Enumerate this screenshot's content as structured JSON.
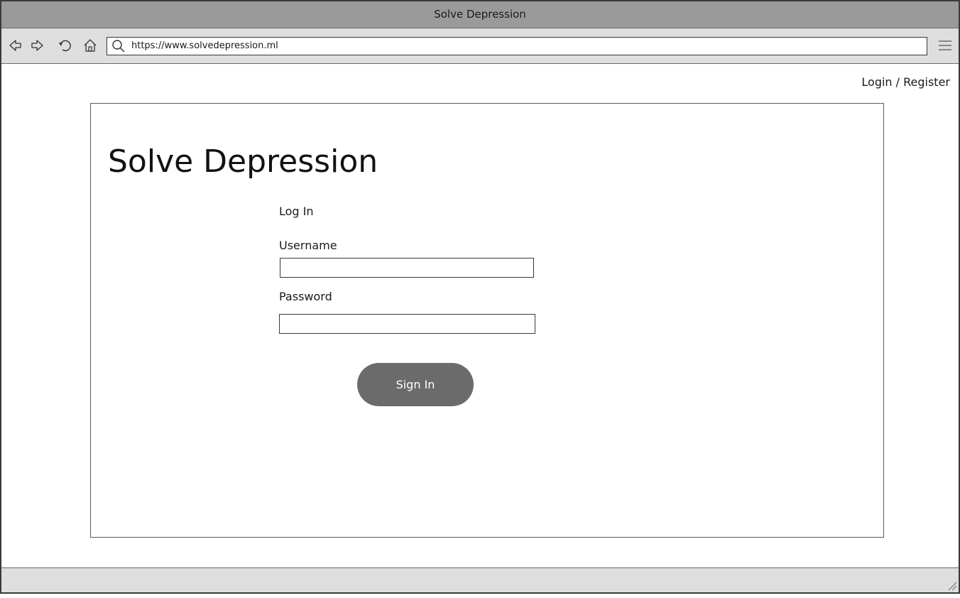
{
  "window": {
    "title": "Solve Depression"
  },
  "browser": {
    "url": "https://www.solvedepression.ml",
    "icons": [
      "back-icon",
      "forward-icon",
      "reload-icon",
      "home-icon",
      "search-icon",
      "menu-icon"
    ]
  },
  "header": {
    "login_link": "Login / Register"
  },
  "main": {
    "site_title": "Solve Depression",
    "form": {
      "heading": "Log In",
      "username_label": "Username",
      "username_value": "",
      "password_label": "Password",
      "password_value": "",
      "submit_label": "Sign In"
    }
  },
  "colors": {
    "titlebar": "#9a9a9a",
    "toolbar": "#dedede",
    "button": "#6b6b6b"
  }
}
